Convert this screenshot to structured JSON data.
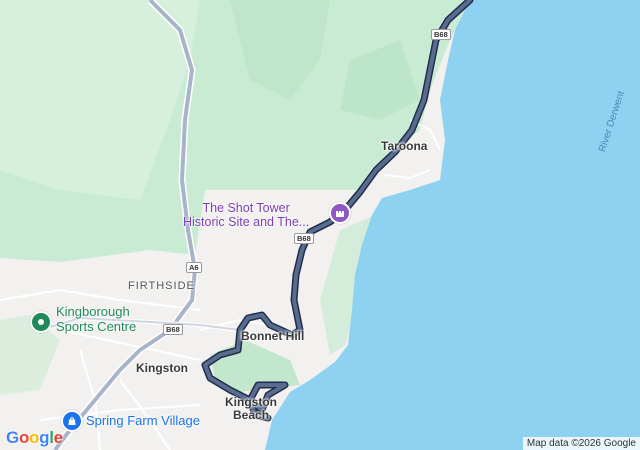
{
  "map": {
    "places": {
      "taroona": "Taroona",
      "firthside": "FIRTHSIDE",
      "bonnet_hill": "Bonnet Hill",
      "kingston": "Kingston",
      "kingston_beach_line1": "Kingston",
      "kingston_beach_line2": "Beach"
    },
    "pois": {
      "shot_tower_line1": "The Shot Tower",
      "shot_tower_line2": "Historic Site and The...",
      "kingborough_line1": "Kingborough",
      "kingborough_line2": "Sports Centre",
      "spring_farm": "Spring Farm Village"
    },
    "water": {
      "river_derwent": "River Derwent"
    },
    "route_shields": {
      "b68_north": "B68",
      "b68_mid": "B68",
      "b68_west": "B68",
      "a6": "A6"
    },
    "icons": {
      "poi_pin_green": "map-pin-park-icon",
      "poi_pin_blue": "map-pin-shopping-icon",
      "poi_pin_purple": "map-pin-landmark-icon"
    },
    "colors": {
      "water": "#8fd1f0",
      "land": "#f2f1ef",
      "forest": "#c9ebd4",
      "route": "#5a6c8e",
      "route_outline": "#1f2d4d",
      "highway": "#a7b4c9"
    },
    "logo_text": "Google",
    "attribution": "Map data ©2026 Google"
  }
}
